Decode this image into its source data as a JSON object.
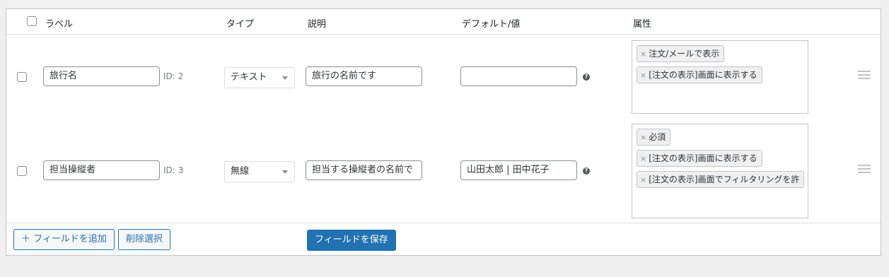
{
  "header": {
    "label": "ラベル",
    "type": "タイプ",
    "description": "説明",
    "default_value": "デフォルト/値",
    "attributes": "属性"
  },
  "rows": [
    {
      "label": "旅行名",
      "id": "ID: 2",
      "type": "テキスト",
      "description": "旅行の名前です",
      "default": "",
      "tags": [
        "注文/メールで表示",
        "[注文の表示]画面に表示する"
      ]
    },
    {
      "label": "担当操縦者",
      "id": "ID: 3",
      "type": "無線",
      "description": "担当する操縦者の名前で",
      "default": "山田太郎 | 田中花子",
      "tags": [
        "必須",
        "[注文の表示]画面に表示する",
        "[注文の表示]画面でフィルタリングを許"
      ]
    }
  ],
  "footer": {
    "add_field": "＋ フィールドを追加",
    "delete_selected": "削除選択",
    "save_fields": "フィールドを保存"
  },
  "icons": {
    "remove": "×",
    "help": "?"
  }
}
